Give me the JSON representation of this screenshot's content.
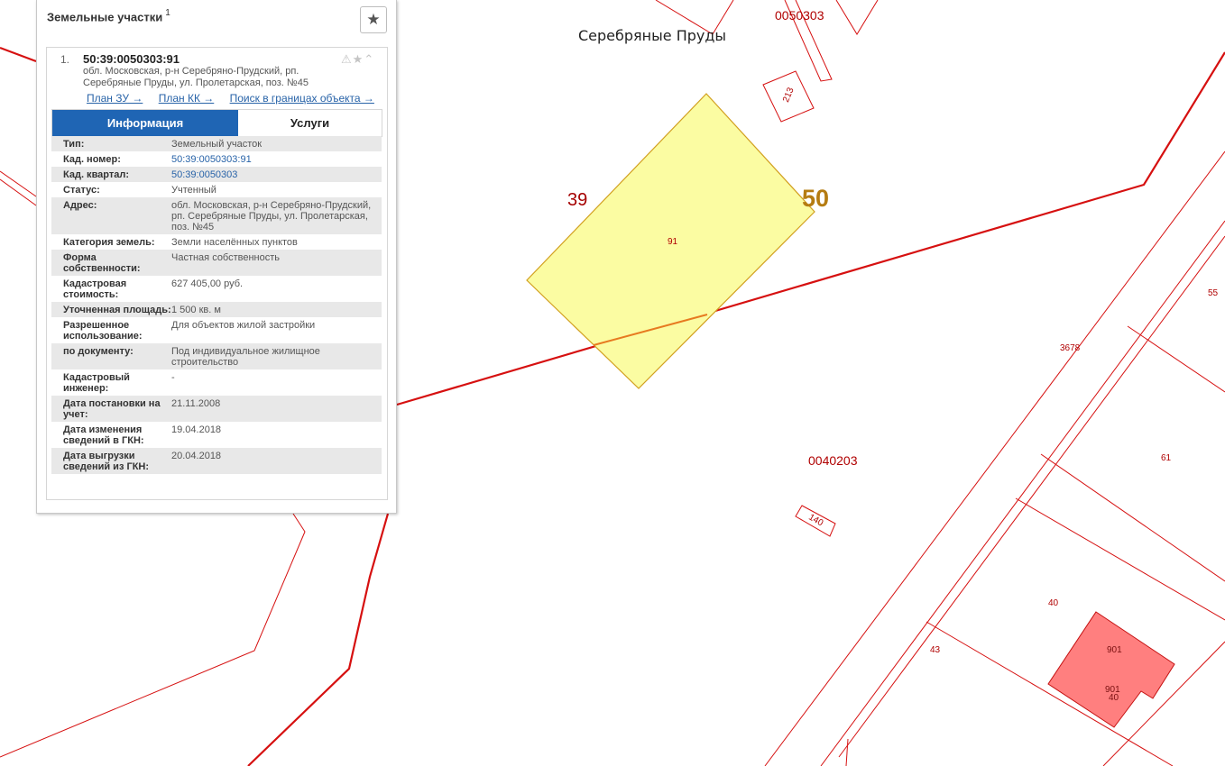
{
  "map": {
    "labels": {
      "quarter_top": "0050303",
      "city": "Серебряные Пруды",
      "district_39": "39",
      "district_50": "50",
      "parcel_91": "91",
      "parcel_213": "213",
      "quarter_bottom": "0040203",
      "parcel_140": "140",
      "parcel_55": "55",
      "parcel_3678": "3678",
      "parcel_61": "61",
      "parcel_40": "40",
      "parcel_43": "43",
      "bldg_901a": "901",
      "bldg_901b": "901",
      "bldg_40": "40"
    },
    "colors": {
      "boundary": "#d61010",
      "selected_fill": "#fbfca2",
      "selected_stroke": "#d2a020",
      "building_fill": "#ff7f7f"
    }
  },
  "panel": {
    "title": "Земельные участки",
    "count": "1",
    "favorite_icon": "star-icon",
    "item": {
      "index": "1.",
      "cad_number": "50:39:0050303:91",
      "address": "обл. Московская, р-н Серебряно-Прудский, рп. Серебряные Пруды, ул. Пролетарская, поз. №45",
      "icons": [
        "warning-icon",
        "star-icon",
        "chevron-up-icon"
      ],
      "links": {
        "plan_zu": "План ЗУ →",
        "plan_kk": "План КК →",
        "search": "Поиск в границах объекта →"
      },
      "tabs": {
        "info": "Информация",
        "services": "Услуги"
      },
      "rows": [
        {
          "key": "Тип:",
          "value": "Земельный участок"
        },
        {
          "key": "Кад. номер:",
          "value": "50:39:0050303:91"
        },
        {
          "key": "Кад. квартал:",
          "value": "50:39:0050303"
        },
        {
          "key": "Статус:",
          "value": "Учтенный"
        },
        {
          "key": "Адрес:",
          "value": "обл. Московская, р-н Серебряно-Прудский, рп. Серебряные Пруды, ул. Пролетарская, поз. №45"
        },
        {
          "key": "Категория земель:",
          "value": "Земли населённых пунктов"
        },
        {
          "key": "Форма собственности:",
          "value": "Частная собственность"
        },
        {
          "key": "Кадастровая стоимость:",
          "value": "627 405,00 руб."
        },
        {
          "key": "Уточненная площадь:",
          "value": "1 500 кв. м"
        },
        {
          "key": "Разрешенное использование:",
          "value": "Для объектов жилой застройки"
        },
        {
          "key": "по документу:",
          "value": "Под индивидуальное жилищное строительство"
        },
        {
          "key": "Кадастровый инженер:",
          "value": "-"
        },
        {
          "key": "Дата постановки на учет:",
          "value": "21.11.2008"
        },
        {
          "key": "Дата изменения сведений в ГКН:",
          "value": "19.04.2018"
        },
        {
          "key": "Дата выгрузки сведений из ГКН:",
          "value": "20.04.2018"
        }
      ]
    }
  }
}
